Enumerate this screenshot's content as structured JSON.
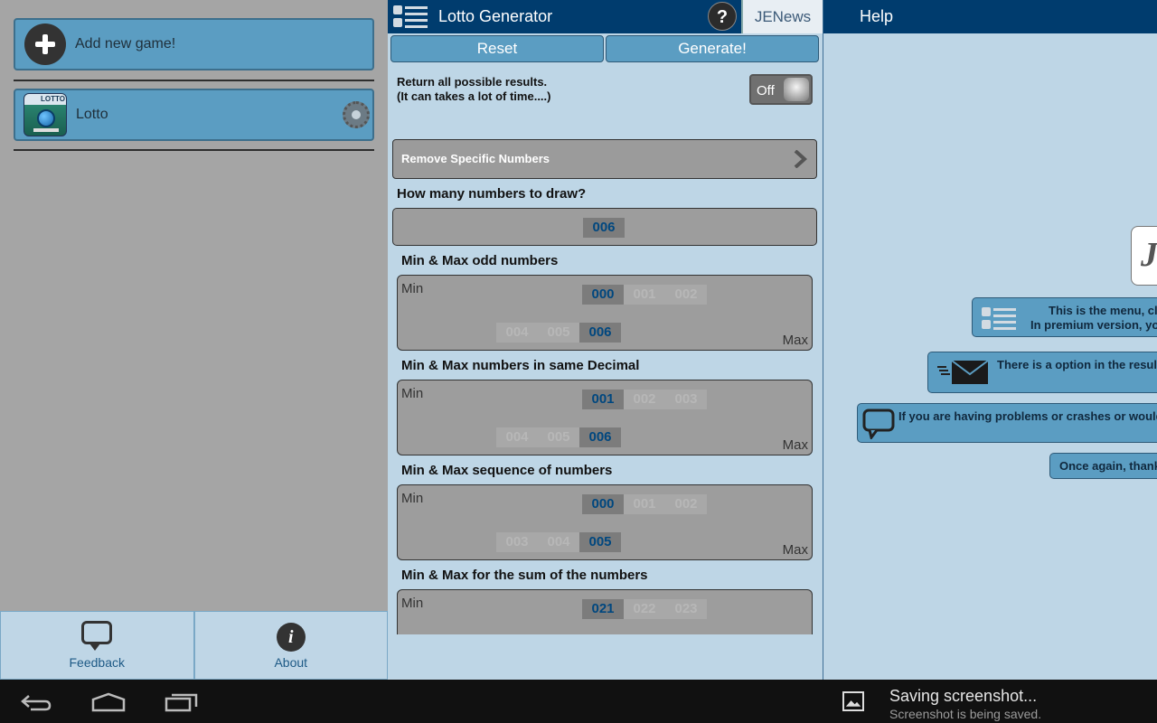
{
  "drawer": {
    "add_game_label": "Add new game!",
    "games": [
      {
        "label": "Lotto",
        "icon_text": "LOTTO"
      }
    ],
    "feedback_label": "Feedback",
    "about_label": "About"
  },
  "toolbar": {
    "title": "Lotto Generator",
    "help_glyph": "?",
    "jenews_label": "JENews",
    "reset_label": "Reset",
    "generate_label": "Generate!"
  },
  "settings": {
    "return_all_line1": "Return all possible results.",
    "return_all_line2": "(It can takes a lot of time....)",
    "toggle_state": "Off",
    "remove_specific_label": "Remove Specific Numbers",
    "draw_question": "How many numbers to draw?",
    "draw_value": "006",
    "min_label": "Min",
    "max_label": "Max",
    "odd": {
      "title": "Min & Max odd numbers",
      "min_options": [
        "000",
        "001",
        "002"
      ],
      "max_options": [
        "004",
        "005",
        "006"
      ]
    },
    "decimal": {
      "title": "Min & Max numbers in same Decimal",
      "min_options": [
        "001",
        "002",
        "003"
      ],
      "max_options": [
        "004",
        "005",
        "006"
      ]
    },
    "sequence": {
      "title": "Min & Max sequence of numbers",
      "min_options": [
        "000",
        "001",
        "002"
      ],
      "max_options": [
        "003",
        "004",
        "005"
      ]
    },
    "sum": {
      "title": "Min & Max for the sum of the numbers",
      "min_options": [
        "021",
        "022",
        "023"
      ]
    }
  },
  "help": {
    "title": "Help",
    "logo_letter": "J",
    "menu_line1": "This is the menu, cli",
    "menu_line2": "In premium version, yo",
    "option_text": "There is a option in the result",
    "problem_text": "If you are having problems or crashes or would",
    "thanks_text": "Once again, thank"
  },
  "notification": {
    "title": "Saving screenshot...",
    "subtitle": "Screenshot is being saved."
  },
  "colors": {
    "accent": "#5b9dc2",
    "header": "#003c6e",
    "panel": "#bed6e6",
    "selected_text": "#00477f"
  }
}
